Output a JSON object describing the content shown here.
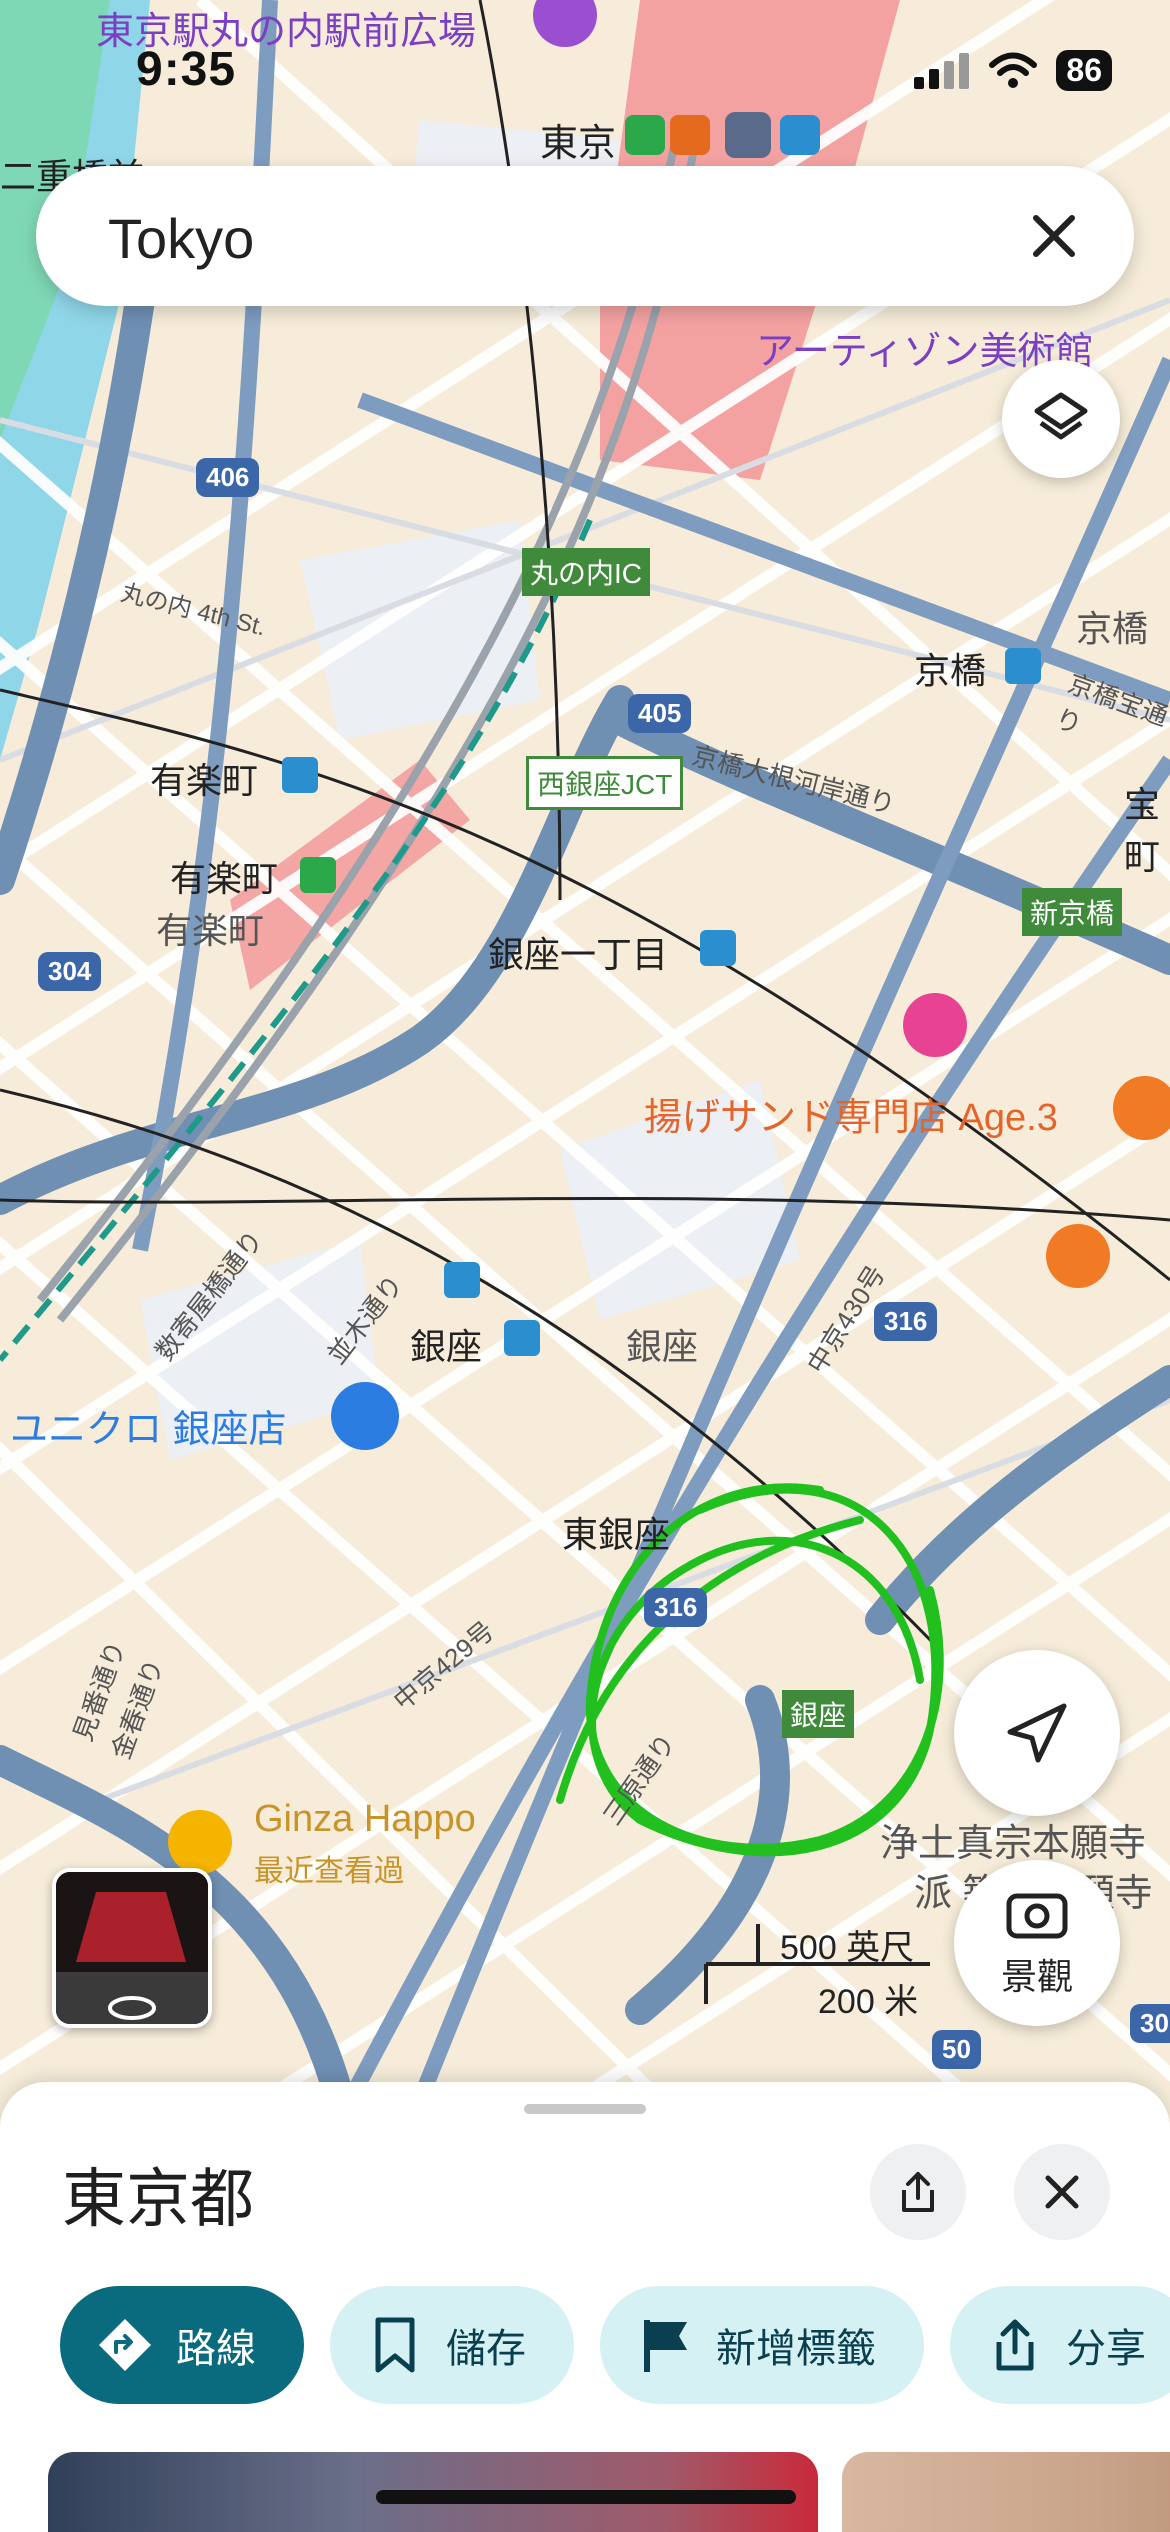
{
  "status": {
    "time": "9:35",
    "battery": "86"
  },
  "search": {
    "query": "Tokyo"
  },
  "map_labels": {
    "tokyo_station_plaza": "東京駅丸の内駅前広場",
    "tokyo": "東京",
    "nijubashi": "二重橋前",
    "artizon": "アーティゾン美術館",
    "route_406": "406",
    "marunouchi_ic": "丸の内IC",
    "marunouchi_4th": "丸の内 4th St.",
    "kyobashi1": "京橋",
    "kyobashi2": "京橋",
    "kyobashi_takara": "京橋宝通り",
    "route_405": "405",
    "nishi_ginza_jct": "西銀座JCT",
    "kyobashi_negishi": "京橋大根河岸通り",
    "takara": "宝町",
    "yurakucho_metro": "有楽町",
    "yurakucho_jr": "有楽町",
    "yurakucho_area": "有楽町",
    "shinkyobashi": "新京橋",
    "route_304": "304",
    "ginza_itchome": "銀座一丁目",
    "agesand": "揚げサンド専門店 Age.3",
    "sukiyabashi": "数寄屋橋通り",
    "namiki": "並木通り",
    "ginza_station": "銀座",
    "ginza_area": "銀座",
    "chuo430": "中京430号",
    "route_316a": "316",
    "uniqlo": "ユニクロ 銀座店",
    "higashi_ginza": "東銀座",
    "route_316b": "316",
    "chuo429": "中京429号",
    "ginza_badge": "銀座",
    "miharu": "見番通り",
    "konharu": "金春通り",
    "ginza_happo": "Ginza Happo",
    "happo_sub": "最近查看過",
    "hongwanji1": "浄土真宗本願寺",
    "hongwanji2": "派 築地本願寺",
    "route_50": "50",
    "route_30": "30",
    "sanjo": "三原通り"
  },
  "scale": {
    "feet": "500 英尺",
    "meters": "200 米"
  },
  "scenic_button": {
    "label": "景觀"
  },
  "sheet": {
    "title": "東京都",
    "chips": [
      {
        "label": "路線",
        "icon": "directions-icon"
      },
      {
        "label": "儲存",
        "icon": "bookmark-icon"
      },
      {
        "label": "新增標籤",
        "icon": "flag-icon"
      },
      {
        "label": "分享",
        "icon": "share-icon"
      }
    ]
  },
  "colors": {
    "road_major": "#6f8fb3",
    "road_minor": "#ffffff",
    "block": "#f6ecd9",
    "rail_area": "#f39a9a",
    "water": "#8fd6e8",
    "park": "#7fd8b5",
    "route_badge": "#3b66a8",
    "green_label": "#3f8a3b",
    "scribble": "#22c01e",
    "chip_primary": "#0b6b7e",
    "chip_secondary": "#d5f1f4"
  }
}
